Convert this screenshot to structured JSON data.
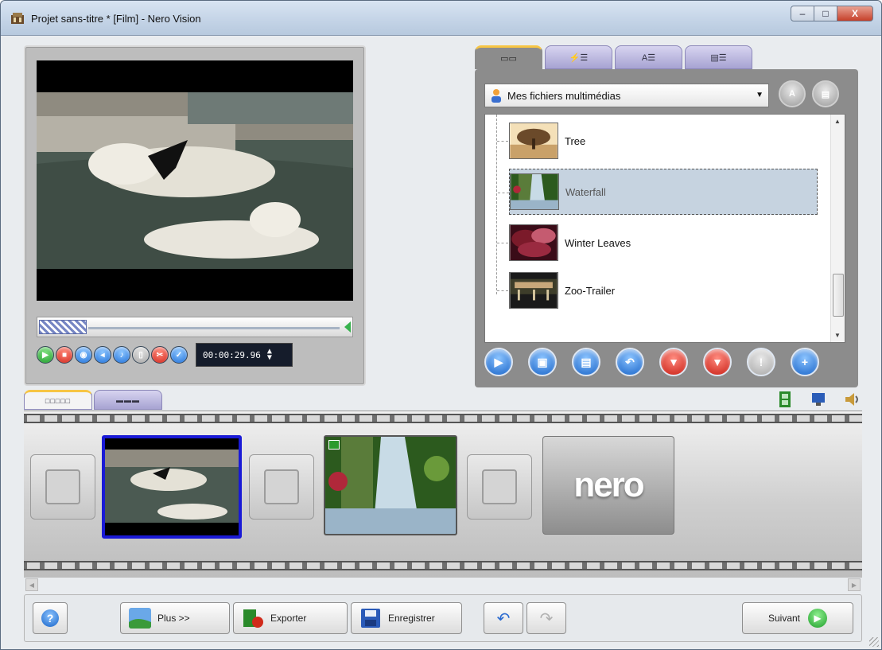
{
  "window": {
    "title": "Projet sans-titre * [Film] - Nero Vision",
    "minimize_icon": "minimize-icon",
    "maximize_icon": "maximize-icon",
    "close_label": "X"
  },
  "preview": {
    "timecode_prefix": "00:00:",
    "timecode_value": "29.96",
    "controls": [
      {
        "name": "play-button",
        "icon": "play-icon",
        "color": "green",
        "glyph": "▶"
      },
      {
        "name": "stop-button",
        "icon": "stop-icon",
        "color": "red",
        "glyph": "■"
      },
      {
        "name": "snapshot-button",
        "icon": "snapshot-icon",
        "color": "blue",
        "glyph": "◉"
      },
      {
        "name": "prev-frame-button",
        "icon": "frame-back-icon",
        "color": "blue",
        "glyph": "◂"
      },
      {
        "name": "volume-button",
        "icon": "volume-icon",
        "color": "blue",
        "glyph": "♪"
      },
      {
        "name": "trim-button",
        "icon": "trim-icon",
        "color": "gray",
        "glyph": "▯"
      },
      {
        "name": "cut-button",
        "icon": "scissors-icon",
        "color": "red",
        "glyph": "✂"
      },
      {
        "name": "confirm-button",
        "icon": "check-icon",
        "color": "blue",
        "glyph": "✓"
      }
    ]
  },
  "library": {
    "tabs": [
      {
        "name": "tab-media",
        "icon": "film-strip-icon",
        "label": "▭▭"
      },
      {
        "name": "tab-effects",
        "icon": "effects-icon",
        "label": "⚡☰"
      },
      {
        "name": "tab-text",
        "icon": "text-icon",
        "label": "A☰"
      },
      {
        "name": "tab-menus",
        "icon": "menu-icon",
        "label": "▤☰"
      }
    ],
    "source": "Mes fichiers multimédias",
    "items": [
      {
        "label": "Tree",
        "thumb_colors": [
          "#6b4a2a",
          "#c9a169",
          "#f4e0b8"
        ],
        "selected": false
      },
      {
        "label": "Waterfall",
        "thumb_colors": [
          "#2c5a1e",
          "#9ab4c8",
          "#5a7c3a"
        ],
        "selected": true
      },
      {
        "label": "Winter Leaves",
        "thumb_colors": [
          "#7b1a2a",
          "#c55b70",
          "#3a0c18"
        ],
        "selected": false
      },
      {
        "label": "Zoo-Trailer",
        "thumb_colors": [
          "#1a1a1a",
          "#c7a77a",
          "#3d3d2a"
        ],
        "selected": false
      }
    ],
    "actions": [
      {
        "name": "play-media-button",
        "icon": "play-media-icon",
        "color": "blue",
        "glyph": "▶"
      },
      {
        "name": "import-button",
        "icon": "import-icon",
        "color": "blue",
        "glyph": "▣"
      },
      {
        "name": "capture-button",
        "icon": "capture-icon",
        "color": "blue",
        "glyph": "▤"
      },
      {
        "name": "undo-import-button",
        "icon": "return-icon",
        "color": "blue",
        "glyph": "↶"
      },
      {
        "name": "delete-button",
        "icon": "delete-icon",
        "color": "red",
        "glyph": "▼"
      },
      {
        "name": "remove-button",
        "icon": "remove-icon",
        "color": "red",
        "glyph": "▼"
      },
      {
        "name": "info-button",
        "icon": "info-icon",
        "color": "gray",
        "glyph": "!"
      },
      {
        "name": "add-button",
        "icon": "plus-icon",
        "color": "blue",
        "glyph": "+"
      }
    ]
  },
  "storyboard": {
    "tabs": [
      {
        "name": "tab-storyboard",
        "label": "□□□□□",
        "active": true
      },
      {
        "name": "tab-timeline",
        "label": "▬▬▬",
        "active": false
      }
    ],
    "view_icons": [
      "film-icon",
      "monitor-icon",
      "speaker-icon"
    ],
    "end_clip_label": "nero"
  },
  "bottom": {
    "help_glyph": "?",
    "more_label": "Plus >>",
    "export_label": "Exporter",
    "save_label": "Enregistrer",
    "next_label": "Suivant"
  }
}
